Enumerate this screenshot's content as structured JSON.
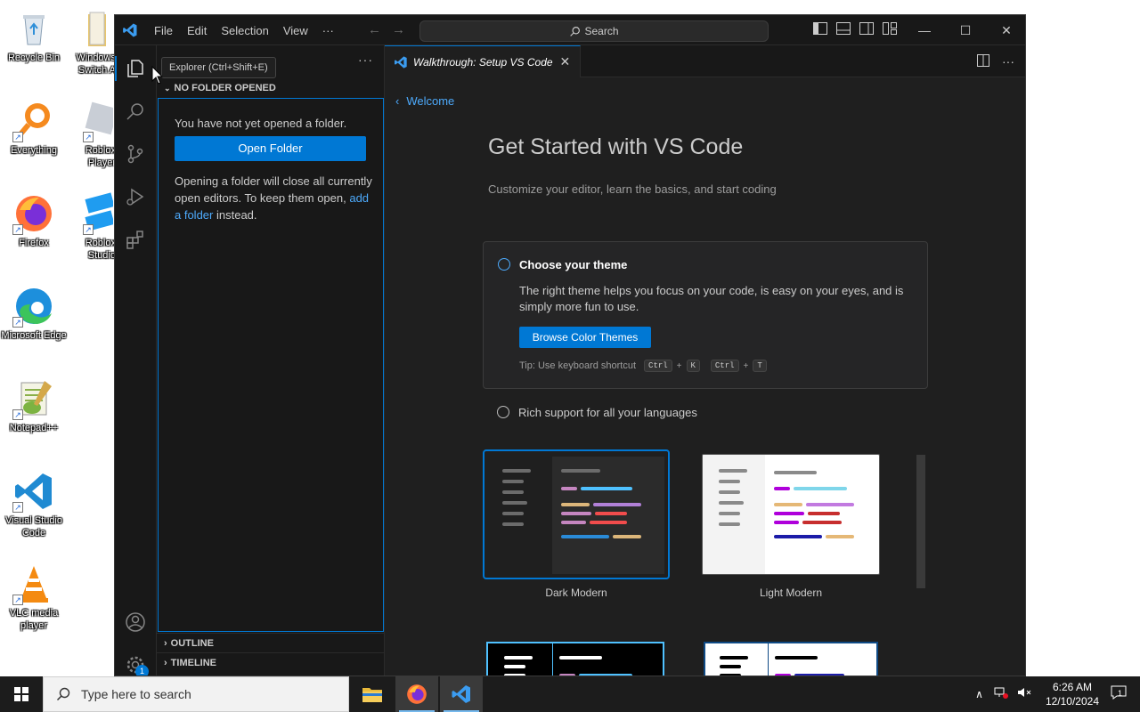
{
  "desktop": {
    "icons": [
      {
        "label": "Recycle Bin"
      },
      {
        "label": "Windows Switch A"
      },
      {
        "label": "Everything"
      },
      {
        "label": "Roblox Player"
      },
      {
        "label": "Firefox"
      },
      {
        "label": "Roblox Studio"
      },
      {
        "label": "Microsoft Edge"
      },
      {
        "label": "Notepad++"
      },
      {
        "label": "Visual Studio Code"
      },
      {
        "label": "VLC media player"
      }
    ]
  },
  "titlebar": {
    "menu": [
      "File",
      "Edit",
      "Selection",
      "View",
      "···"
    ],
    "search_label": "Search"
  },
  "tooltip": "Explorer (Ctrl+Shift+E)",
  "activitybar": {
    "accounts_badge": "1"
  },
  "sidebar": {
    "more": "···",
    "section": "NO FOLDER OPENED",
    "no_folder_text": "You have not yet opened a folder.",
    "open_folder": "Open Folder",
    "info_before": "Opening a folder will close all currently open editors. To keep them open, ",
    "info_link": "add a folder",
    "info_after": " instead.",
    "outline": "OUTLINE",
    "timeline": "TIMELINE"
  },
  "editor": {
    "tab_label": "Walkthrough: Setup VS Code",
    "back_label": "Welcome",
    "title": "Get Started with VS Code",
    "subtitle": "Customize your editor, learn the basics, and start coding",
    "step1": {
      "title": "Choose your theme",
      "desc": "The right theme helps you focus on your code, is easy on your eyes, and is simply more fun to use.",
      "button": "Browse Color Themes",
      "tip_prefix": "Tip: Use keyboard shortcut",
      "keys1": [
        "Ctrl",
        "K"
      ],
      "keys2": [
        "Ctrl",
        "T"
      ]
    },
    "step2": {
      "title": "Rich support for all your languages"
    },
    "themes": [
      {
        "name": "Dark Modern"
      },
      {
        "name": "Light Modern"
      }
    ]
  },
  "taskbar": {
    "search_placeholder": "Type here to search",
    "time": "6:26 AM",
    "date": "12/10/2024",
    "notification_count": "1"
  },
  "colors": {
    "accent": "#0078d4",
    "link": "#4daafc",
    "editor_bg": "#1f1f1f",
    "sidebar_bg": "#181818"
  }
}
